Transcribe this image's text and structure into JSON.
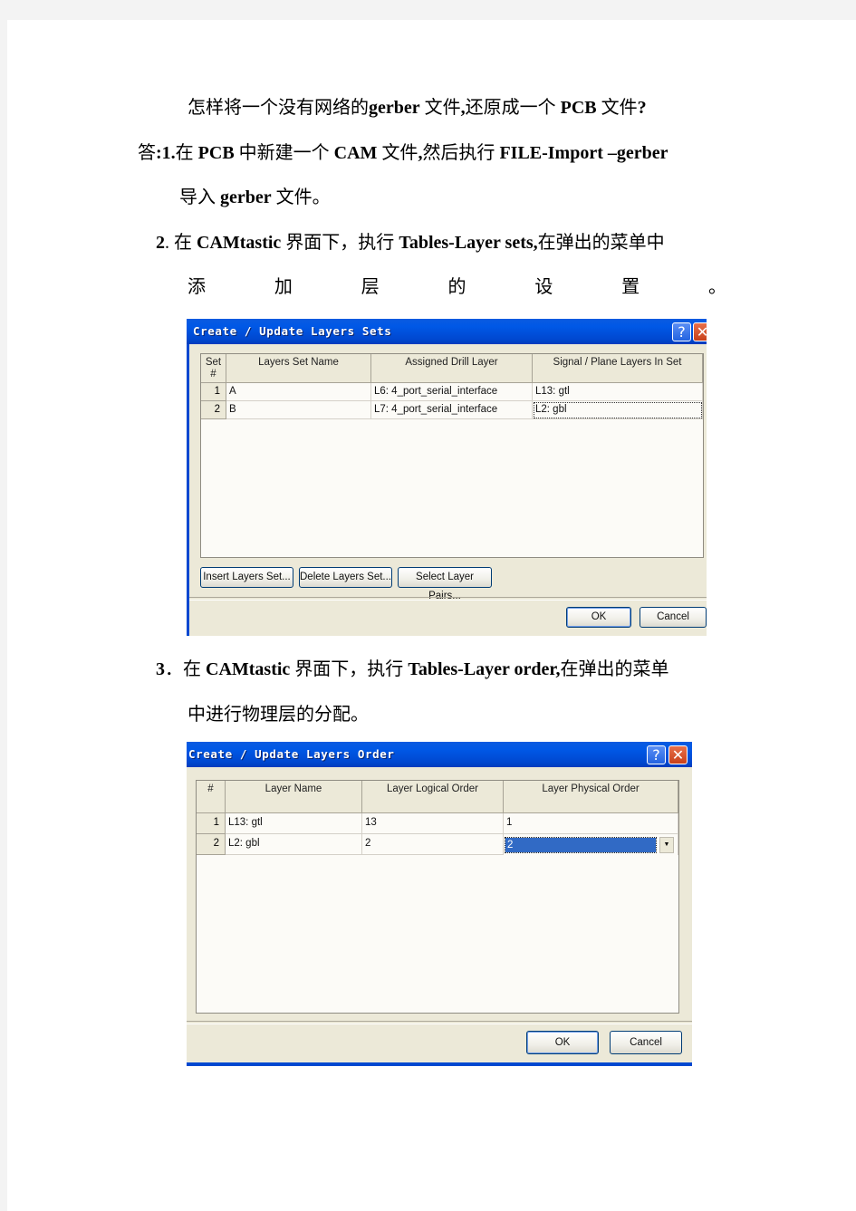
{
  "document": {
    "title_parts": [
      {
        "t": "怎样将一个没有网络的",
        "b": false
      },
      {
        "t": "gerber",
        "b": true
      },
      {
        "t": " 文件",
        "b": false
      },
      {
        "t": ",",
        "b": true
      },
      {
        "t": "还原成一个 ",
        "b": false
      },
      {
        "t": "PCB",
        "b": true
      },
      {
        "t": " 文件",
        "b": false
      },
      {
        "t": "?",
        "b": true
      }
    ],
    "step1_line1": [
      {
        "t": "答",
        "b": false
      },
      {
        "t": ":1.",
        "b": true
      },
      {
        "t": "在 ",
        "b": false
      },
      {
        "t": "PCB",
        "b": true
      },
      {
        "t": " 中新建一个 ",
        "b": false
      },
      {
        "t": "CAM",
        "b": true
      },
      {
        "t": " 文件",
        "b": false
      },
      {
        "t": ",",
        "b": true
      },
      {
        "t": "然后执行 ",
        "b": false
      },
      {
        "t": "FILE-Import  –gerber",
        "b": true
      }
    ],
    "step1_line2": [
      {
        "t": "导入 ",
        "b": false
      },
      {
        "t": "gerber",
        "b": true
      },
      {
        "t": " 文件。",
        "b": false
      }
    ],
    "step2_line1": [
      {
        "t": "2",
        "b": true
      },
      {
        "t": ". 在 ",
        "b": false
      },
      {
        "t": "CAMtastic",
        "b": true
      },
      {
        "t": " 界面下，执行 ",
        "b": false
      },
      {
        "t": "Tables-Layer  sets,",
        "b": true
      },
      {
        "t": "在弹出的菜单中",
        "b": false
      }
    ],
    "step2_line2_chars": [
      "添",
      "加",
      "层",
      "的",
      "设",
      "置",
      "。"
    ],
    "step3_line1": [
      {
        "t": "3",
        "b": true
      },
      {
        "t": "．在 ",
        "b": false
      },
      {
        "t": "CAMtastic",
        "b": true
      },
      {
        "t": " 界面下，执行 ",
        "b": false
      },
      {
        "t": "Tables-Layer  order,",
        "b": true
      },
      {
        "t": "在弹出的菜单",
        "b": false
      }
    ],
    "step3_line2": "中进行物理层的分配。"
  },
  "dialog_sets": {
    "title": "Create / Update Layers Sets",
    "help_glyph": "?",
    "close_glyph": "✕",
    "columns": [
      "Set #",
      "Layers Set Name",
      "Assigned Drill Layer",
      "Signal / Plane Layers In Set"
    ],
    "col_set_line1": "Set",
    "col_set_line2": "#",
    "rows": [
      {
        "num": "1",
        "name": "A",
        "drill": "L6: 4_port_serial_interface",
        "layers": "L13: gtl"
      },
      {
        "num": "2",
        "name": "B",
        "drill": "L7: 4_port_serial_interface",
        "layers": "L2: gbl"
      }
    ],
    "buttons": {
      "insert": "Insert Layers Set...",
      "delete": "Delete Layers Set...",
      "select_pairs": "Select Layer Pairs...",
      "ok": "OK",
      "cancel": "Cancel"
    }
  },
  "dialog_order": {
    "title": "Create / Update Layers Order",
    "help_glyph": "?",
    "close_glyph": "✕",
    "columns": [
      "#",
      "Layer Name",
      "Layer Logical Order",
      "Layer Physical Order"
    ],
    "rows": [
      {
        "num": "1",
        "name": "L13: gtl",
        "logical": "13",
        "physical": "1"
      },
      {
        "num": "2",
        "name": "L2: gbl",
        "logical": "2",
        "physical": "2"
      }
    ],
    "dropdown_glyph": "▼",
    "buttons": {
      "ok": "OK",
      "cancel": "Cancel"
    },
    "colors": {
      "selection": "#316ac5",
      "titlebar": "#0054e3"
    }
  }
}
